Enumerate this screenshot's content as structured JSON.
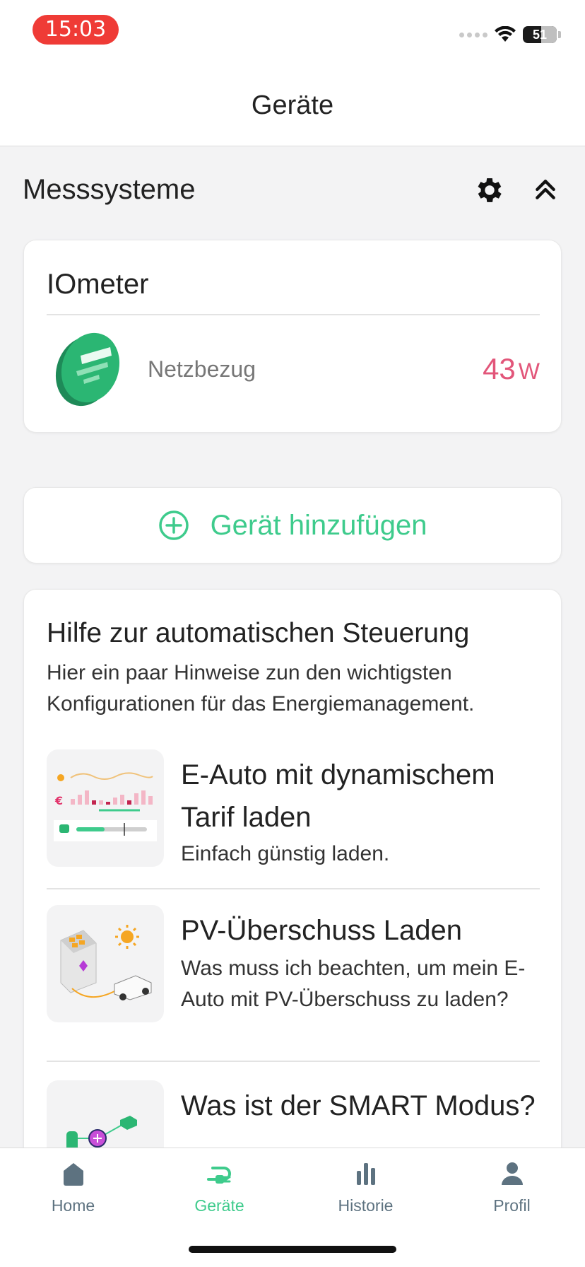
{
  "status": {
    "time": "15:03",
    "battery": "51"
  },
  "header": {
    "title": "Geräte"
  },
  "section": {
    "title": "Messsysteme"
  },
  "meter": {
    "name": "IOmeter",
    "label": "Netzbezug",
    "value": "43",
    "unit": "W"
  },
  "add_device": {
    "label": "Gerät hinzufügen"
  },
  "help": {
    "title": "Hilfe zur automatischen Steuerung",
    "subtitle": "Hier ein paar Hinweise zun den wichtigsten Konfigurationen für das Energiemanagement.",
    "items": [
      {
        "title": "E-Auto mit dynamischem Tarif laden",
        "description": "Einfach günstig laden."
      },
      {
        "title": "PV-Überschuss Laden",
        "description": "Was muss ich beachten, um mein E-Auto mit PV-Überschuss zu laden?"
      },
      {
        "title": "Was ist der SMART Modus?",
        "description": ""
      }
    ]
  },
  "tabs": [
    {
      "label": "Home",
      "icon": "home-icon"
    },
    {
      "label": "Geräte",
      "icon": "plug-icon",
      "active": true
    },
    {
      "label": "Historie",
      "icon": "bar-chart-icon"
    },
    {
      "label": "Profil",
      "icon": "user-icon"
    }
  ],
  "colors": {
    "accent": "#3ecb8c",
    "power": "#e2567a",
    "status_pill": "#ef3b36",
    "tab_inactive": "#5d7280"
  }
}
